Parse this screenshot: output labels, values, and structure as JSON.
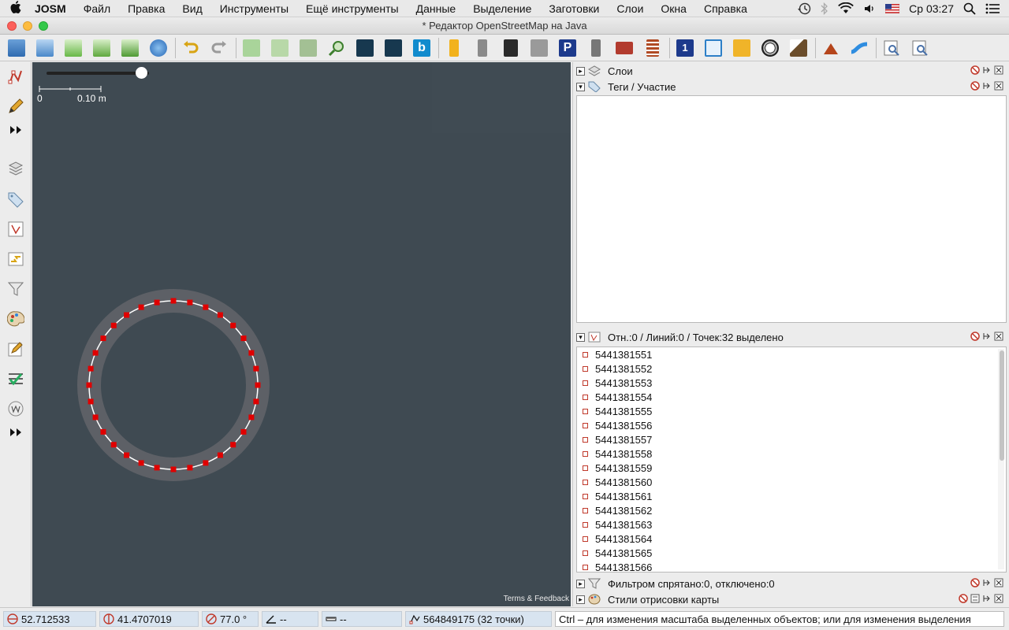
{
  "menubar": {
    "app": "JOSM",
    "items": [
      "Файл",
      "Правка",
      "Вид",
      "Инструменты",
      "Ещё инструменты",
      "Данные",
      "Выделение",
      "Заготовки",
      "Слои",
      "Окна",
      "Справка"
    ],
    "clock": "Ср 03:27"
  },
  "window": {
    "title": "* Редактор OpenStreetMap на Java"
  },
  "map": {
    "scale_zero": "0",
    "scale_label": "0.10 m",
    "attribution": "Terms & Feedback",
    "zoom_level": 0.92,
    "colors": {
      "background": "#3f4a52",
      "ring": "#5d6066",
      "node": "#e00000",
      "way": "#ffffff"
    }
  },
  "panels": {
    "layers": {
      "title": "Слои"
    },
    "tags": {
      "title": "Теги / Участие"
    },
    "selection": {
      "title": "Отн.:0 / Линий:0 / Точек:32 выделено",
      "items": [
        "5441381551",
        "5441381552",
        "5441381553",
        "5441381554",
        "5441381555",
        "5441381556",
        "5441381557",
        "5441381558",
        "5441381559",
        "5441381560",
        "5441381561",
        "5441381562",
        "5441381563",
        "5441381564",
        "5441381565",
        "5441381566"
      ]
    },
    "filter": {
      "title": "Фильтром спрятано:0, отключено:0"
    },
    "styles": {
      "title": "Стили отрисовки карты"
    }
  },
  "statusbar": {
    "lat": "52.712533",
    "lon": "41.4707019",
    "heading": "77.0 °",
    "angle": "--",
    "distance": "--",
    "selection_info": "564849175 (32 точки)",
    "message": "Ctrl – для изменения масштаба выделенных объектов; или для изменения выделения"
  }
}
